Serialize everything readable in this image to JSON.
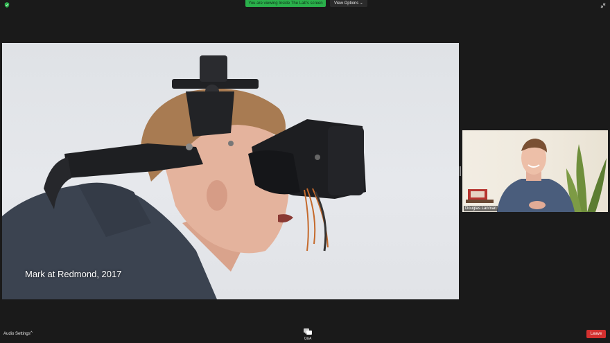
{
  "banner": {
    "text": "You are viewing Inside The Lab's screen"
  },
  "view_options": {
    "label": "View Options"
  },
  "shared_screen": {
    "caption": "Mark at Redmond, 2017"
  },
  "participant": {
    "name": "Douglas Lanman"
  },
  "bottom": {
    "audio_settings": "Audio Settings",
    "qa_label": "Q&A",
    "leave_label": "Leave"
  },
  "colors": {
    "banner": "#2ab04b",
    "leave": "#d3302f",
    "background": "#1a1a1a"
  }
}
